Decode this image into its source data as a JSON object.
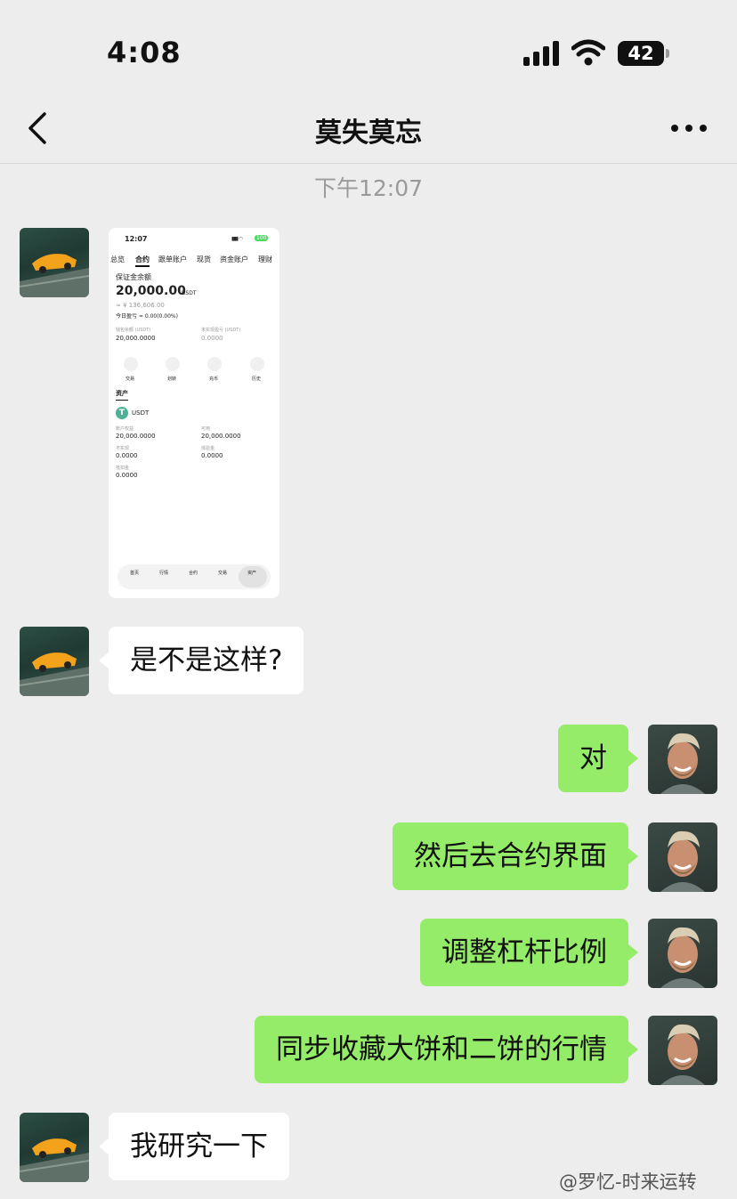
{
  "status_bar": {
    "time": "4:08",
    "battery": "42"
  },
  "chat": {
    "title": "莫失莫忘"
  },
  "timestamp": "下午12:07",
  "image_message": {
    "status_time": "12:07",
    "badge": "100",
    "tabs": [
      "总览",
      "合约",
      "跟单账户",
      "现货",
      "资金账户",
      "理财"
    ],
    "balance_label": "保证金余额",
    "balance": "20,000.00",
    "balance_unit": "USDT",
    "approx": "≈ ¥ 136,606.00",
    "today_pnl": "今日盈亏 ≈ 0.00(0.00%)",
    "wallet_label": "钱包余额 (USDT)",
    "wallet_value": "20,000.0000",
    "unrealized_label": "未实现盈亏 (USDT)",
    "unrealized_value": "0.0000",
    "actions": [
      "交易",
      "划转",
      "充币",
      "历史"
    ],
    "assets_heading": "资产",
    "coin": "USDT",
    "equity_label": "账户权益",
    "equity_value": "20,000.0000",
    "available_label": "可用",
    "available_value": "20,000.0000",
    "unrealized2_label": "不实现",
    "unrealized2_value": "0.0000",
    "frozen_label": "体验金",
    "frozen_value": "0.0000",
    "bonus_label": "抵扣金",
    "bonus_value": "0.0000",
    "nav": [
      "首页",
      "行情",
      "合约",
      "交易",
      "资产"
    ]
  },
  "messages": [
    {
      "side": "left",
      "text": "是不是这样?"
    },
    {
      "side": "right",
      "text": "对"
    },
    {
      "side": "right",
      "text": "然后去合约界面"
    },
    {
      "side": "right",
      "text": "调整杠杆比例"
    },
    {
      "side": "right",
      "text": "同步收藏大饼和二饼的行情"
    },
    {
      "side": "left",
      "text": "我研究一下"
    }
  ],
  "watermark": "@罗忆-时来运转",
  "colors": {
    "background": "#ededed",
    "outgoing_bubble": "#95ec69",
    "incoming_bubble": "#ffffff",
    "tether_green": "#50af95"
  }
}
